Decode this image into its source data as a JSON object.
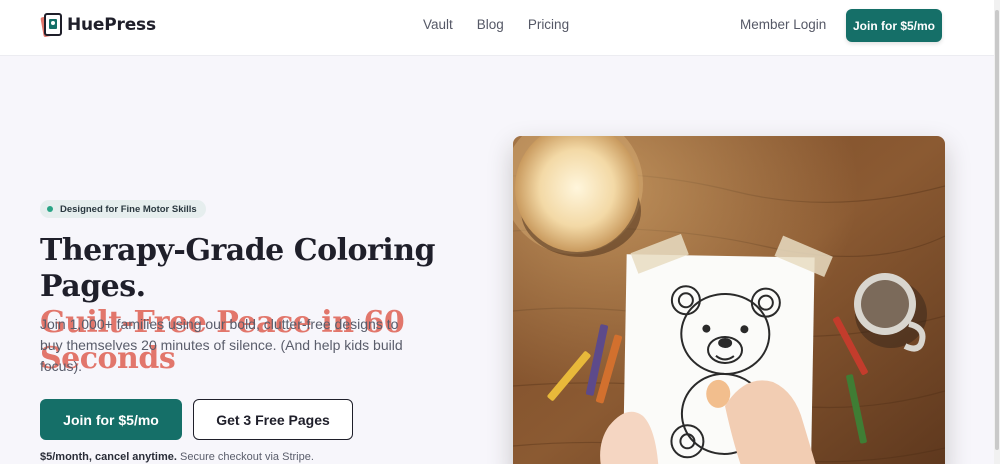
{
  "nav": {
    "brand": "HuePress",
    "links": [
      "Vault",
      "Blog",
      "Pricing"
    ],
    "member_login": "Member Login",
    "cta": "Join for $5/mo"
  },
  "hero": {
    "badge": "Designed for Fine Motor Skills",
    "title_line1": "Therapy-Grade Coloring Pages.",
    "title_line2": "Guilt-Free Peace in 60 Seconds",
    "subtitle": "Join 1,000+ families using our bold, clutter-free designs to buy themselves 20 minutes of silence. (And help kids build focus).",
    "primary_cta": "Join for $5/mo",
    "secondary_cta": "Get 3 Free Pages",
    "fine_print_bold": "$5/month, cancel anytime.",
    "fine_print": "Secure checkout via Stripe."
  },
  "colors": {
    "brand_teal": "#156f68",
    "accent_coral": "#e2766b",
    "badge_dot": "#2aa486"
  },
  "icons": {
    "logo": "coloring-page-stack-icon"
  }
}
